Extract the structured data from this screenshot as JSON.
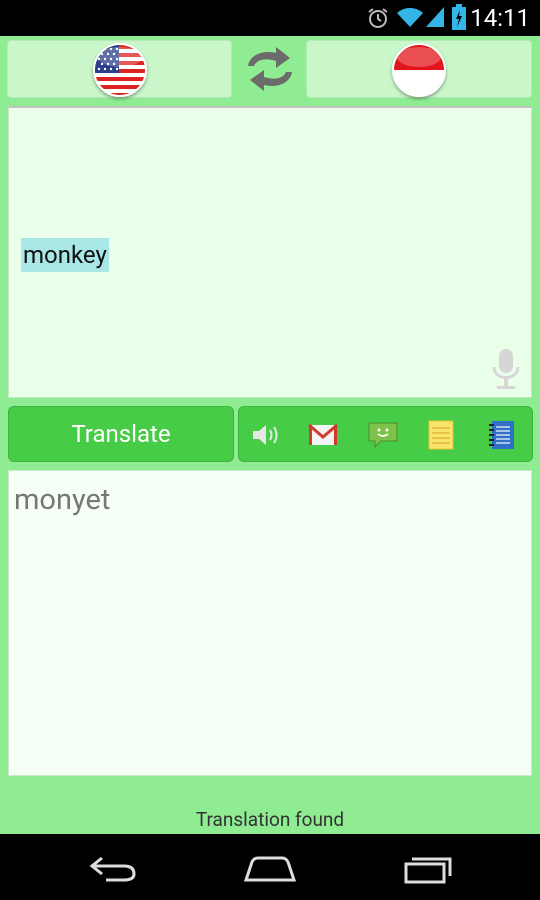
{
  "status_bar": {
    "time": "14:11",
    "icons": [
      "alarm-icon",
      "wifi-icon",
      "signal-icon",
      "battery-charging-icon"
    ]
  },
  "languages": {
    "source": {
      "name": "English",
      "flag": "us-flag-icon"
    },
    "target": {
      "name": "Indonesian",
      "flag": "indonesia-flag-icon"
    },
    "swap_icon": "swap-icon"
  },
  "input": {
    "text": "monkey",
    "mic_icon": "microphone-icon"
  },
  "actions": {
    "translate_label": "Translate",
    "tools": [
      "speaker-icon",
      "gmail-icon",
      "sms-icon",
      "notes-icon",
      "notebook-icon"
    ]
  },
  "output": {
    "text": "monyet"
  },
  "status_message": "Translation found",
  "nav": [
    "back-icon",
    "home-icon",
    "recents-icon"
  ],
  "colors": {
    "background": "#90ec92",
    "button": "#46cc47",
    "input_bg": "#eaffea",
    "output_bg": "#f6fff6",
    "selection": "#a9e7e7"
  }
}
